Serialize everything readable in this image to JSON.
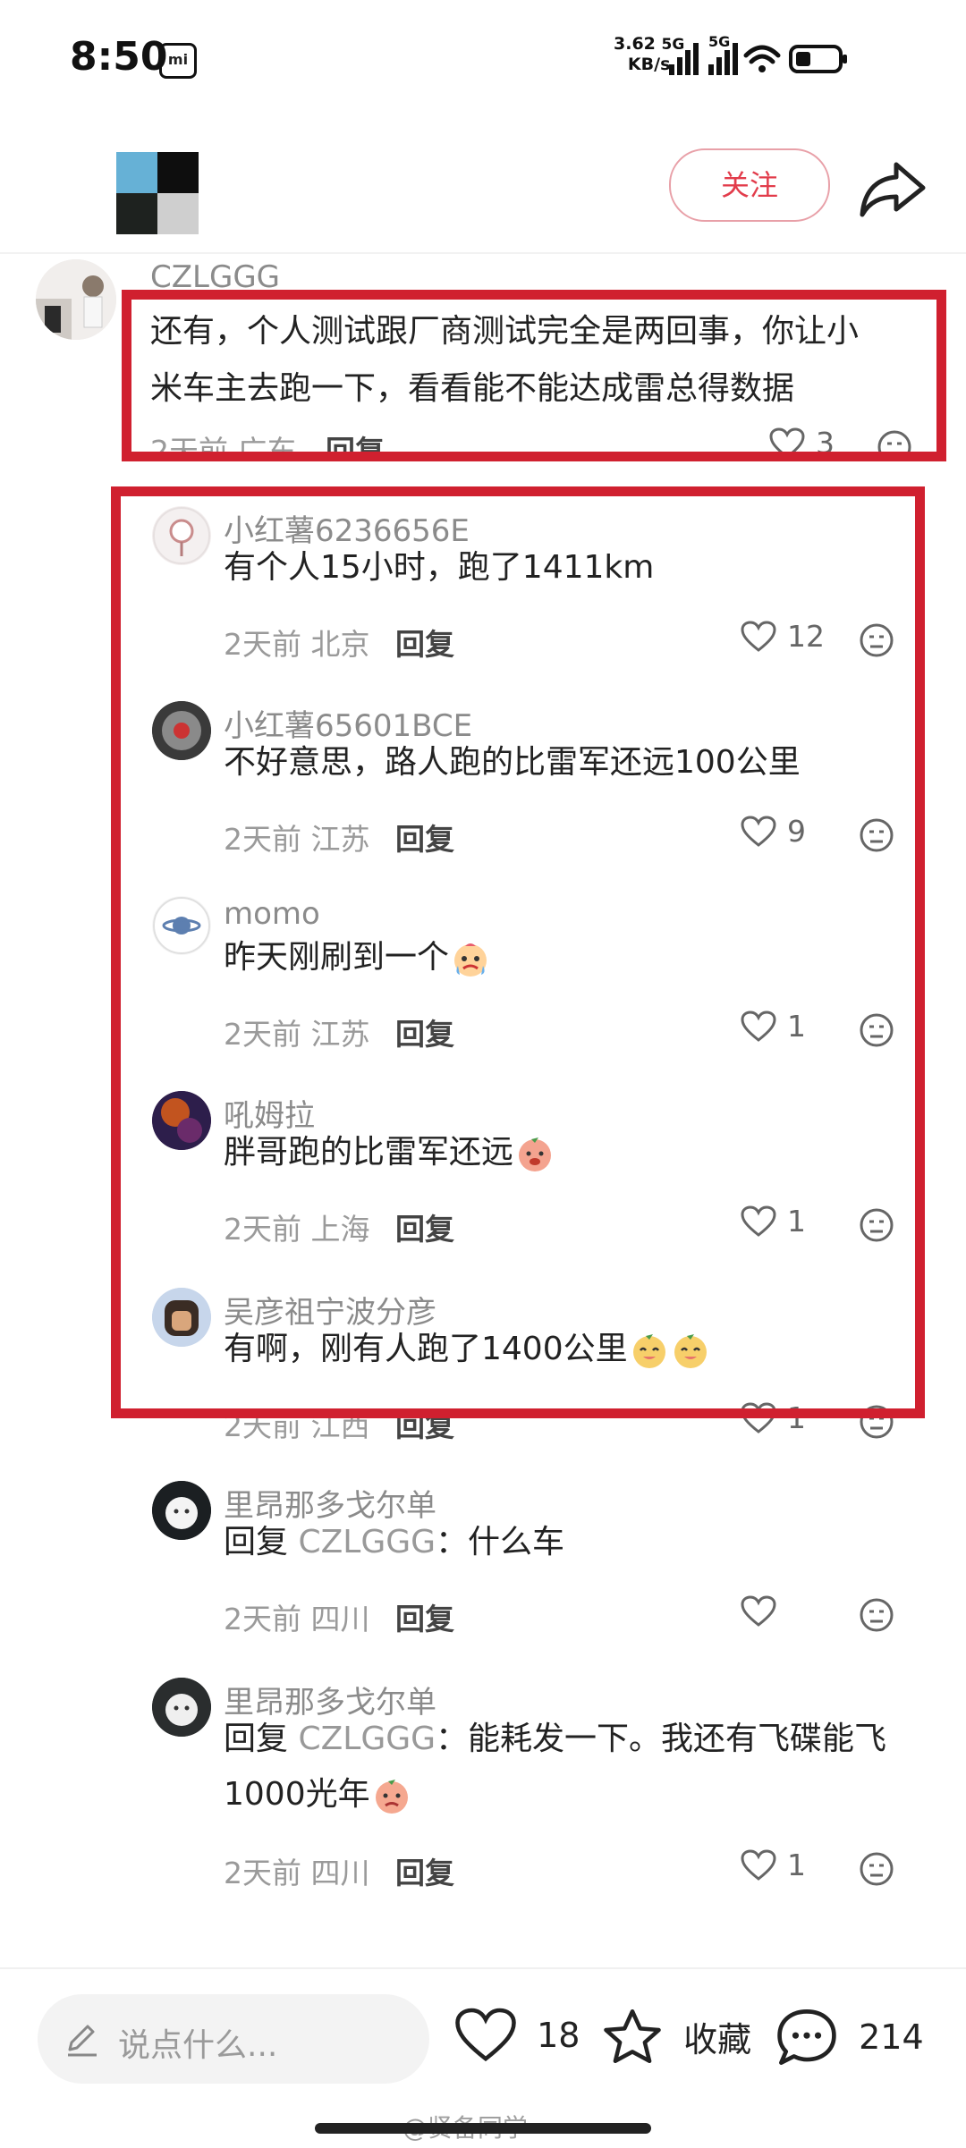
{
  "status_bar": {
    "time": "8:50",
    "speed": "3.62",
    "speed_unit": "KB/s",
    "net1": "5G",
    "net2": "5G"
  },
  "header": {
    "follow_label": "关注"
  },
  "main_comment": {
    "username": "CZLGGG",
    "text_line1": "还有，个人测试跟厂商测试完全是两回事，你让小",
    "text_line2": "米车主去跑一下，看看能不能达成雷总得数据",
    "meta": "2天前 广东",
    "reply_label": "回复",
    "likes": "3"
  },
  "replies": [
    {
      "username": "小红薯6236656E",
      "text": "有个人15小时，跑了1411km",
      "meta": "2天前 北京",
      "reply_label": "回复",
      "likes": "12"
    },
    {
      "username": "小红薯65601BCE",
      "text": "不好意思，路人跑的比雷军还远100公里",
      "meta": "2天前 江苏",
      "reply_label": "回复",
      "likes": "9"
    },
    {
      "username": "momo",
      "text": "昨天刚刷到一个",
      "meta": "2天前 江苏",
      "reply_label": "回复",
      "likes": "1",
      "emoji": "crying-face"
    },
    {
      "username": "吼姆拉",
      "text": "胖哥跑的比雷军还远",
      "meta": "2天前 上海",
      "reply_label": "回复",
      "likes": "1",
      "emoji": "peach-blush"
    },
    {
      "username": "吴彦祖宁波分彦",
      "text": "有啊，刚有人跑了1400公里",
      "meta": "2天前 江西",
      "reply_label": "回复",
      "likes": "1",
      "emoji": "peach-smile"
    },
    {
      "username": "里昂那多戈尔单",
      "reply_prefix": "回复",
      "reply_target": "CZLGGG",
      "text": "：什么车",
      "meta": "2天前 四川",
      "reply_label": "回复",
      "likes": ""
    },
    {
      "username": "里昂那多戈尔单",
      "reply_prefix": "回复",
      "reply_target": "CZLGGG",
      "text": "：能耗发一下。我还有飞碟能飞",
      "text_line2": "1000光年",
      "meta": "2天前 四川",
      "reply_label": "回复",
      "likes": "1",
      "emoji": "peach-cry"
    }
  ],
  "bottom_bar": {
    "input_placeholder": "说点什么...",
    "like_count": "18",
    "collect_label": "收藏",
    "comment_count": "214",
    "watermark": "@贤备同学"
  },
  "colors": {
    "accent": "#e23c4b",
    "highlight": "#d0202f",
    "muted": "#9a9a9a"
  }
}
